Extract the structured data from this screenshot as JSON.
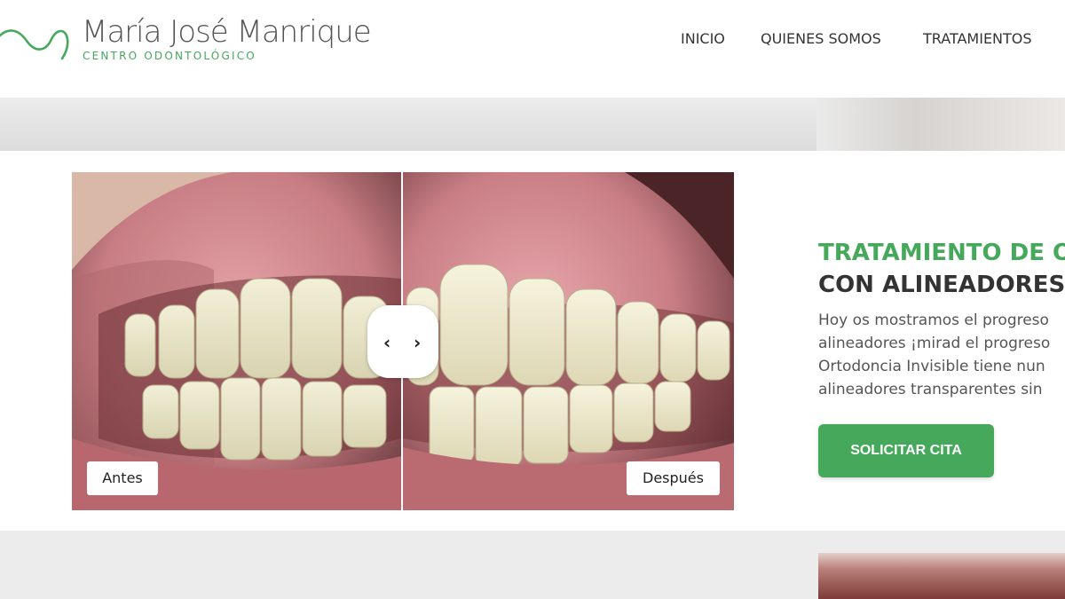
{
  "header": {
    "logo": {
      "name": "María José Manrique",
      "subtitle": "CENTRO ODONTOLÓGICO",
      "icon": "wave-logo-icon"
    },
    "nav": {
      "items": [
        {
          "label": "INICIO"
        },
        {
          "label": "QUIENES SOMOS"
        },
        {
          "label": "TRATAMIENTOS"
        }
      ]
    }
  },
  "comparison": {
    "before_label": "Antes",
    "after_label": "Después",
    "handle_icons": [
      "chevron-left-icon",
      "chevron-right-icon"
    ]
  },
  "content": {
    "title_line1": "TRATAMIENTO DE O",
    "title_line2": "CON ALINEADORES",
    "body_lines": [
      "Hoy os mostramos el progreso",
      "alineadores ¡mirad el progreso",
      "Ortodoncia Invisible tiene nun",
      "alineadores transparentes sin"
    ],
    "cta_label": "SOLICITAR CITA"
  },
  "colors": {
    "accent_green": "#45a85a",
    "text_dark": "#333333",
    "text_body": "#555555"
  }
}
